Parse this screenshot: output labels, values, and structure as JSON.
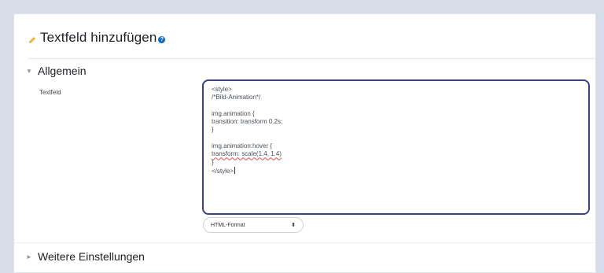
{
  "header": {
    "title": "Textfeld hinzufügen",
    "help_glyph": "?"
  },
  "sections": {
    "general": {
      "label": "Allgemein",
      "chevron": "▼"
    },
    "more": {
      "label": "Weitere Einstellungen",
      "chevron": "►"
    }
  },
  "field": {
    "label": "Textfeld",
    "lines": [
      "<style>",
      "/*Bild-Animation*/",
      "",
      "img.animation {",
      "transition: transform 0.2s;",
      "}",
      "",
      "img.animation:hover {",
      "transform: scale(1.4, 1.4)",
      "}",
      "</style>"
    ]
  },
  "format_select": {
    "value": "HTML-Format",
    "arrows": "⬍"
  },
  "colors": {
    "accent": "#0f6cbf",
    "editor_border": "#3a3f8f",
    "pencil": "#f0b429"
  }
}
